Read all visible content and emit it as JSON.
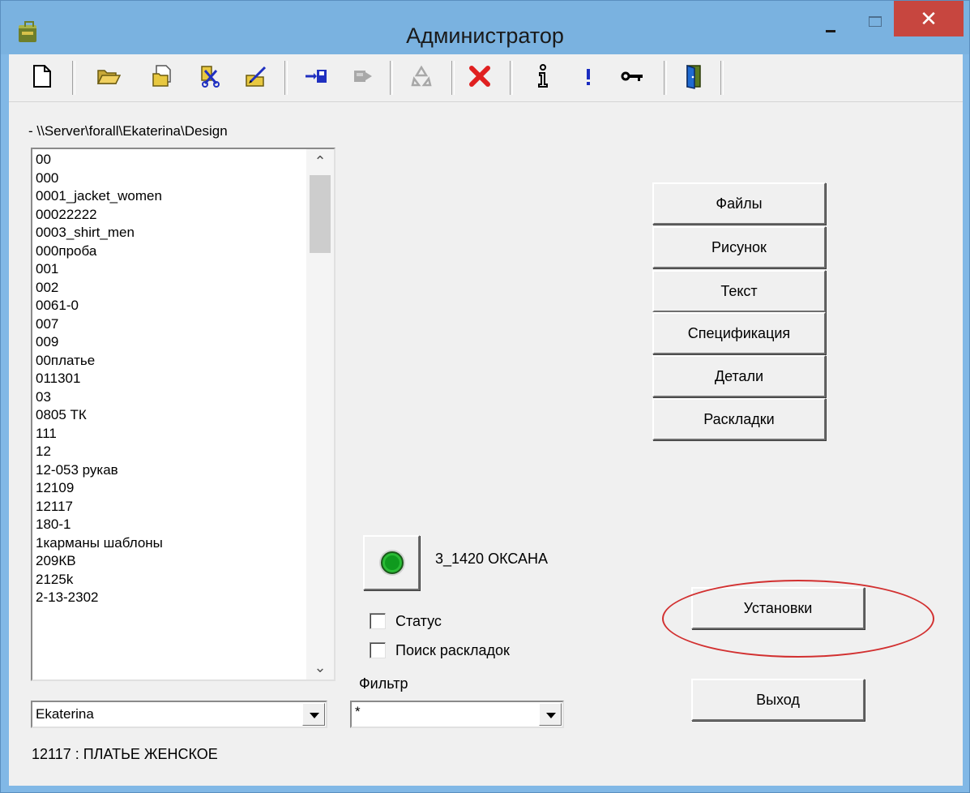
{
  "window": {
    "title": "Администратор",
    "close_glyph": "✕"
  },
  "toolbar": {
    "icons": [
      "new-file-icon",
      "open-folder-icon",
      "copy-folder-icon",
      "cut-icon",
      "edit-icon",
      "save-right-icon",
      "move-right-icon",
      "recycle-icon",
      "delete-icon",
      "info-icon",
      "exclamation-icon",
      "key-icon",
      "exit-door-icon"
    ]
  },
  "path": "- \\\\Server\\forall\\Ekaterina\\Design",
  "list": {
    "items": [
      "00",
      "000",
      "0001_jacket_women",
      "00022222",
      "0003_shirt_men",
      "000проба",
      "001",
      "002",
      "0061-0",
      "007",
      "009",
      "00платье",
      "011301",
      "03",
      "0805 ТК",
      "111",
      "12",
      "12-053 рукав",
      "12109",
      "12117",
      "180-1",
      "1карманы шаблоны",
      "209КВ",
      "2125k",
      "2-13-2302"
    ],
    "scroll_up": "⌃",
    "scroll_down": "⌄"
  },
  "user_combo": {
    "value": "Ekaterina"
  },
  "status_text": "12117 : ПЛАТЬЕ ЖЕНСКОЕ",
  "buttons": {
    "files": "Файлы",
    "drawing": "Рисунок",
    "text": "Текст",
    "specification": "Спецификация",
    "details": "Детали",
    "layouts": "Раскладки",
    "settings": "Установки",
    "exit": "Выход"
  },
  "user_label": "3_1420 ОКСАНА",
  "checkboxes": {
    "status": "Статус",
    "layout_search": "Поиск раскладок"
  },
  "filter": {
    "label": "Фильтр",
    "value": "*"
  },
  "colors": {
    "titlebar": "#7ab2e0",
    "close": "#c7463f",
    "annotation": "#d23030",
    "led": "#0f9a1e"
  }
}
